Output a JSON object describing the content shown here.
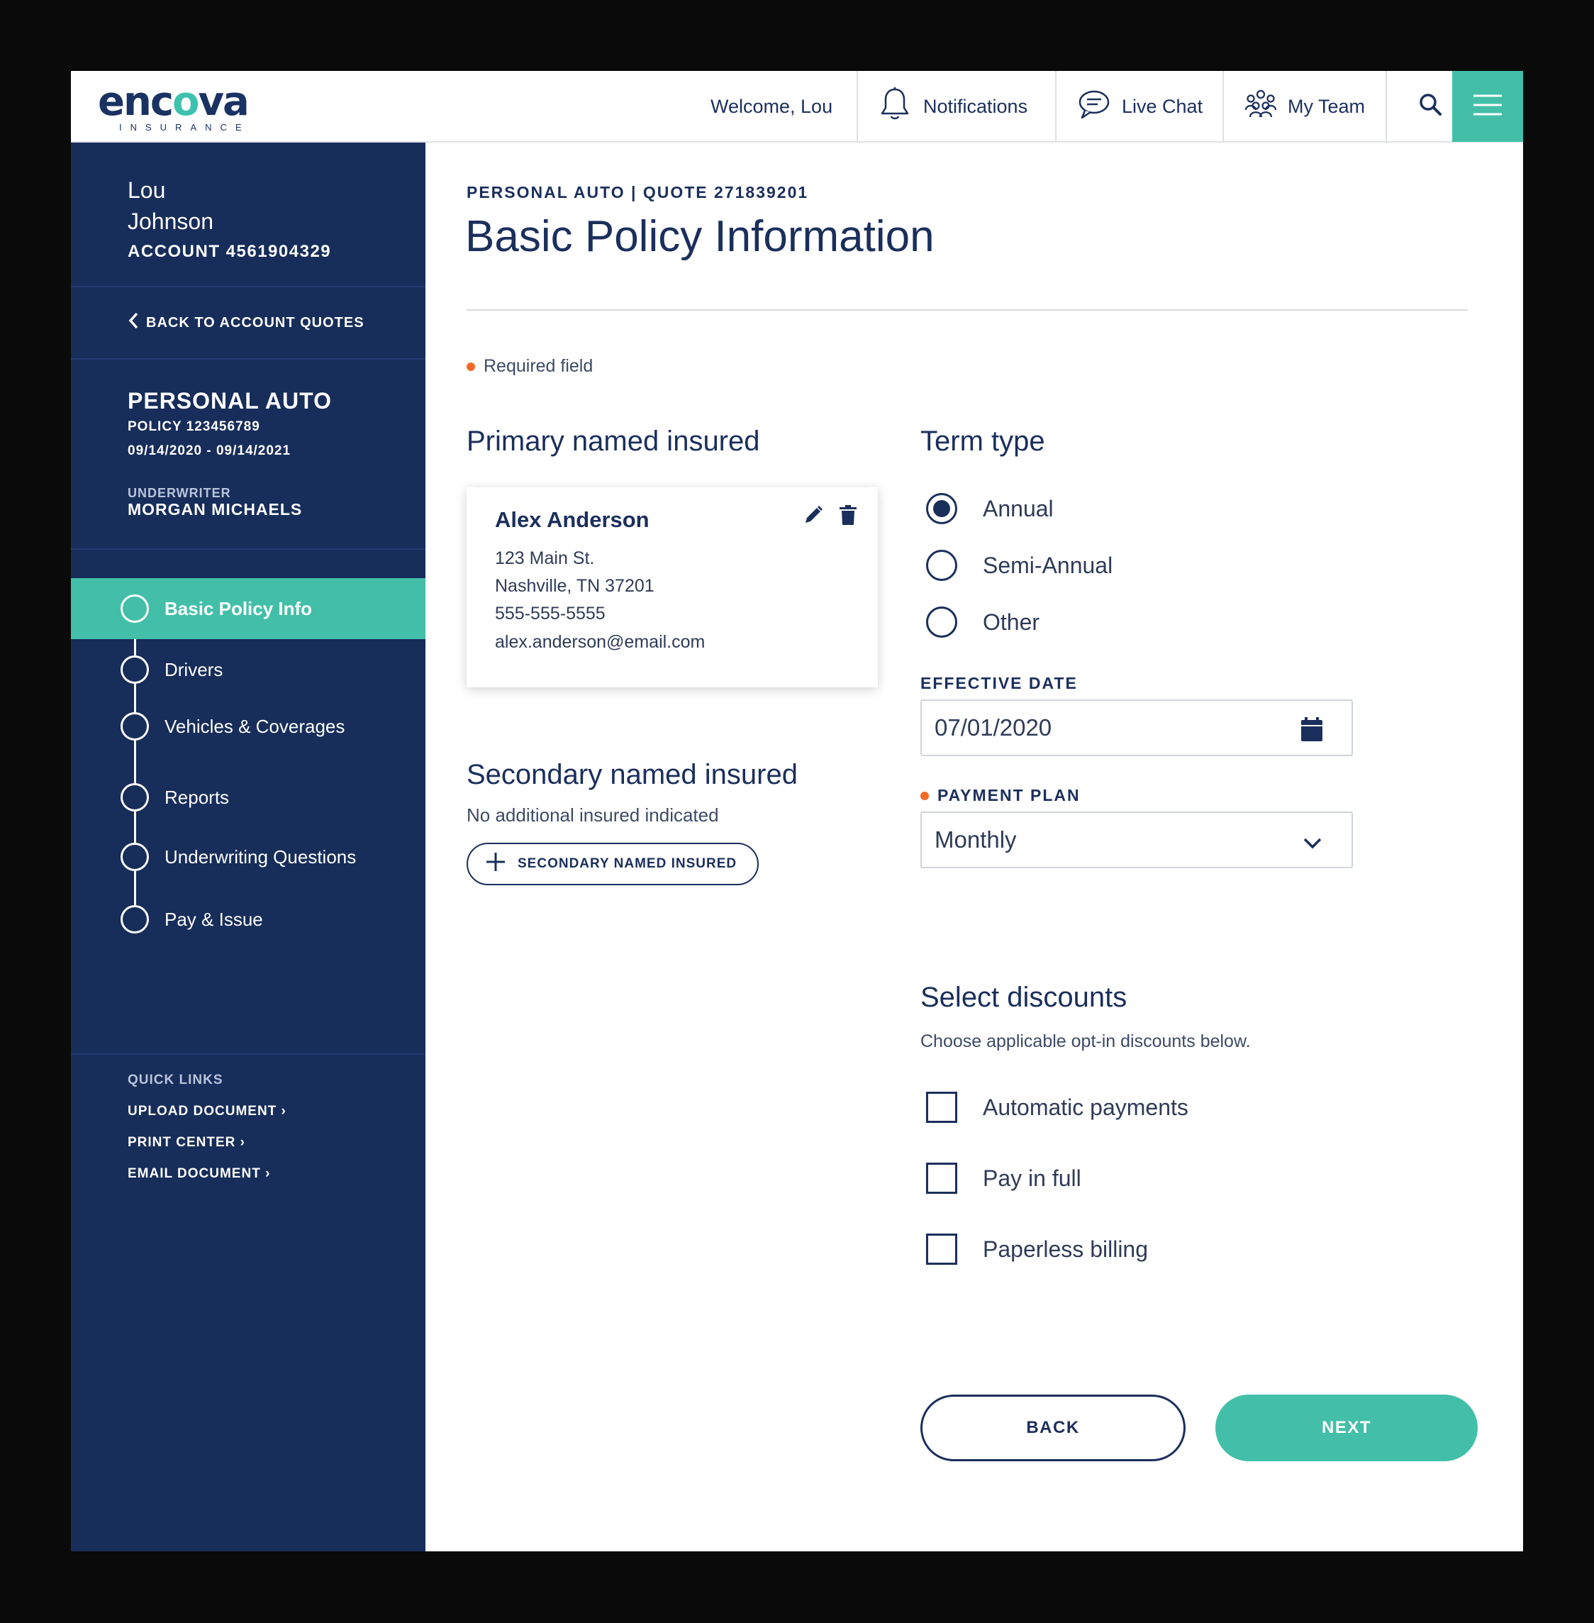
{
  "header": {
    "logo_text_a": "enc",
    "logo_text_b": "o",
    "logo_text_c": "va",
    "logo_sub": "INSURANCE",
    "welcome": "Welcome, Lou",
    "notifications": "Notifications",
    "live_chat": "Live Chat",
    "my_team": "My Team"
  },
  "sidebar": {
    "account_first": "Lou",
    "account_last": "Johnson",
    "account_number": "ACCOUNT 4561904329",
    "back_link": "BACK TO ACCOUNT QUOTES",
    "policy_title": "PERSONAL AUTO",
    "policy_number": "POLICY 123456789",
    "policy_dates": "09/14/2020 - 09/14/2021",
    "underwriter_label": "UNDERWRITER",
    "underwriter_name": "MORGAN MICHAELS",
    "steps": [
      {
        "label": "Basic Policy Info",
        "active": true
      },
      {
        "label": "Drivers",
        "active": false
      },
      {
        "label": "Vehicles & Coverages",
        "active": false
      },
      {
        "label": "Reports",
        "active": false
      },
      {
        "label": "Underwriting Questions",
        "active": false
      },
      {
        "label": "Pay & Issue",
        "active": false
      }
    ],
    "quick_links_label": "QUICK LINKS",
    "quick_links": [
      "UPLOAD DOCUMENT ›",
      "PRINT CENTER ›",
      "EMAIL DOCUMENT ›"
    ]
  },
  "main": {
    "breadcrumb": "PERSONAL AUTO | QUOTE 271839201",
    "title": "Basic Policy Information",
    "required_note": "Required field",
    "primary_heading": "Primary named insured",
    "primary": {
      "name": "Alex Anderson",
      "address1": "123 Main St.",
      "address2": "Nashville, TN 37201",
      "phone": "555-555-5555",
      "email": "alex.anderson@email.com"
    },
    "secondary_heading": "Secondary named insured",
    "secondary_none": "No additional insured indicated",
    "secondary_button": "SECONDARY NAMED INSURED",
    "term_heading": "Term type",
    "term_options": [
      {
        "label": "Annual",
        "checked": true
      },
      {
        "label": "Semi-Annual",
        "checked": false
      },
      {
        "label": "Other",
        "checked": false
      }
    ],
    "effective_date_label": "EFFECTIVE DATE",
    "effective_date_value": "07/01/2020",
    "payment_plan_label": "PAYMENT PLAN",
    "payment_plan_value": "Monthly",
    "discounts_heading": "Select discounts",
    "discounts_hint": "Choose applicable opt-in discounts below.",
    "discounts": [
      {
        "label": "Automatic payments",
        "checked": false
      },
      {
        "label": "Pay in full",
        "checked": false
      },
      {
        "label": "Paperless billing",
        "checked": false
      }
    ],
    "back_button": "BACK",
    "next_button": "NEXT"
  },
  "colors": {
    "navy": "#172d5a",
    "teal": "#43bfa9",
    "required_dot": "#f36a25"
  },
  "icons": [
    "bell-icon",
    "chat-icon",
    "team-icon",
    "search-icon",
    "menu-icon",
    "chevron-left-icon",
    "pencil-icon",
    "trash-icon",
    "calendar-icon",
    "chevron-down-icon",
    "plus-icon"
  ]
}
